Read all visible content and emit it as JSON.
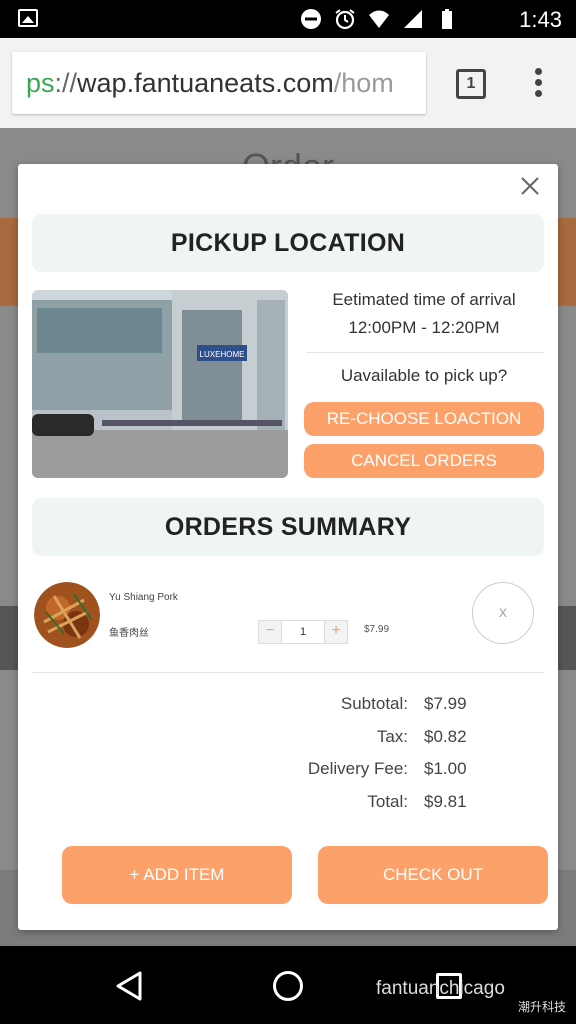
{
  "status_bar": {
    "time": "1:43"
  },
  "browser": {
    "url_scheme": "ps",
    "url_sep": "://",
    "url_host": "wap.fantuaneats.com",
    "url_rest": "/hom",
    "tab_count": "1"
  },
  "background_page": {
    "title": "Order"
  },
  "modal": {
    "pickup_title": "PICKUP LOCATION",
    "eta_label": "Eetimated time of arrival",
    "eta_time": "12:00PM - 12:20PM",
    "unavailable_text": "Uavailable to pick up?",
    "rechoose_label": "RE-CHOOSE LOACTION",
    "cancel_label": "CANCEL ORDERS",
    "photo_sign": "LUXEHOME",
    "summary_title": "ORDERS SUMMARY",
    "items": [
      {
        "name": "Yu Shiang Pork",
        "name_cn": "鱼香肉丝",
        "quantity": "1",
        "price": "$7.99",
        "remove": "x",
        "minus": "−",
        "plus": "+"
      }
    ],
    "totals": [
      {
        "label": "Subtotal:",
        "value": "$7.99"
      },
      {
        "label": "Tax:",
        "value": "$0.82"
      },
      {
        "label": "Delivery Fee:",
        "value": "$1.00"
      },
      {
        "label": "Total:",
        "value": "$9.81"
      }
    ],
    "add_item_label": "+ ADD ITEM",
    "checkout_label": "CHECK OUT"
  },
  "watermark": {
    "text": "fantuanchicago",
    "brand": "潮升科技"
  },
  "colors": {
    "accent": "#fda16a",
    "section_bg": "#eff4f5"
  }
}
